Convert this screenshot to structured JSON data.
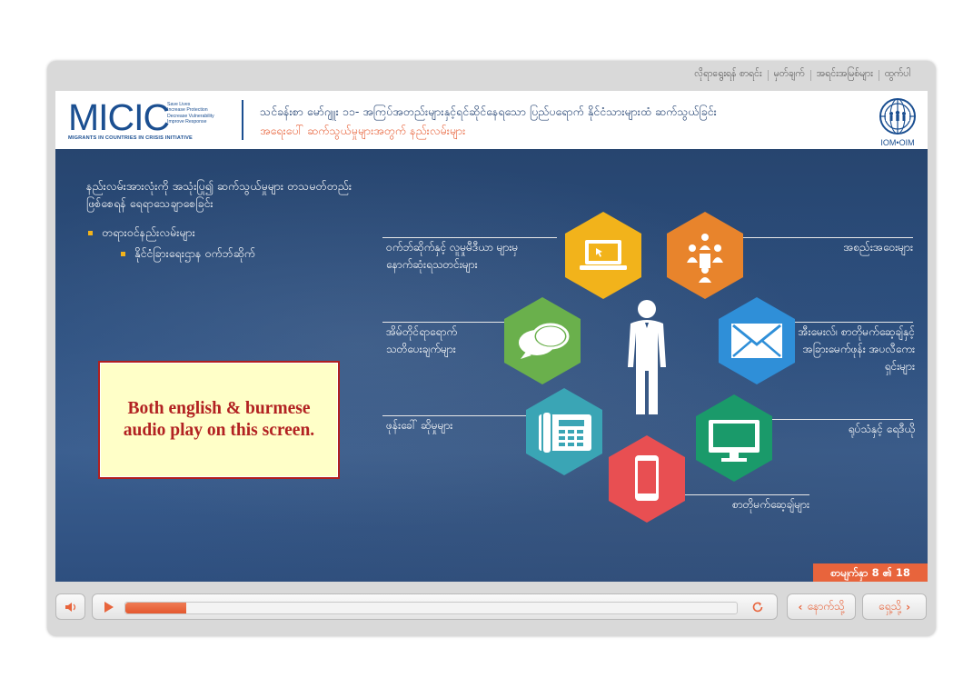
{
  "top_links": [
    "လိုရာရွေးရန် စာရင်း",
    "မှတ်ချက်",
    "အရင်းအမြစ်များ",
    "ထွက်ပါ"
  ],
  "header": {
    "logo_text": "MICIC",
    "logo_tagline": [
      "Save Lives",
      "Increase Protection",
      "Decrease Vulnerability",
      "Improve Response"
    ],
    "logo_subtitle": "MIGRANTS IN COUNTRIES IN CRISIS INITIATIVE",
    "title_line1": "သင်ခန်းစာ မော်ဂျူး ၁၁- အကြပ်အတည်းများနှင့်ရင်ဆိုင်နေရသော ပြည်ပရောက် နိုင်ငံသားများထံ ဆက်သွယ်ခြင်း",
    "title_line2": "အရေးပေါ် ဆက်သွယ်မှုများအတွက် နည်းလမ်းများ",
    "org_logo_text": "IOM•OIM"
  },
  "slide": {
    "heading": "နည်းလမ်းအားလုံးကို အသုံးပြု၍ ဆက်သွယ်မှုများ တသမတ်တည်းဖြစ်စေရန် ရေရာသေချာစေခြင်း",
    "bullet1": "တရားဝင်နည်းလမ်းများ",
    "bullet2": "နိုင်ငံခြားရေးဌာန ဝက်ဘ်ဆိုက်",
    "note": "Both english & burmese audio play on this screen.",
    "labels": {
      "website": "ဝက်ဘ်ဆိုက်နှင့် လူမှုမီဒီယာ များမှ နောက်ဆုံးရသတင်းများ",
      "meetings": "အစည်းအဝေးများ",
      "sms": "အိမ်တိုင်ရာရောက် သတိပေးချက်များ",
      "email": "အီးမေးလ်၊ စာတိုမက်ဆေ့ချ်နှင့် အခြားမေက်ဖုန်း အပလီကေးရှင်းများ",
      "phone": "ဖုန်းခေါ် ဆိုမှုများ",
      "tv": "ရုပ်သံနှင့် ရေဒီယို",
      "mobile": "စာတိုမက်ဆေ့ချ်များ"
    },
    "page_indicator": "စာမျက်နှာ 8 ၏ 18"
  },
  "controls": {
    "progress": 0.1,
    "back_label": "နောက်သို့",
    "next_label": "ရှေ့သို့"
  },
  "colors": {
    "accent": "#e8643c",
    "brand": "#1b4f91",
    "hex_yellow": "#f2b31b",
    "hex_orange": "#e8842c",
    "hex_green": "#6ab04c",
    "hex_blue": "#2f8fd8",
    "hex_teal": "#3aa5b5",
    "hex_darkgreen": "#1a9a6a",
    "hex_red": "#e84f52"
  },
  "icons": [
    "volume-icon",
    "play-icon",
    "replay-icon",
    "chevron-left-icon",
    "chevron-right-icon",
    "laptop-icon",
    "meeting-icon",
    "speech-bubbles-icon",
    "envelope-icon",
    "phone-icon",
    "tv-icon",
    "mobile-phone-icon",
    "person-icon"
  ]
}
